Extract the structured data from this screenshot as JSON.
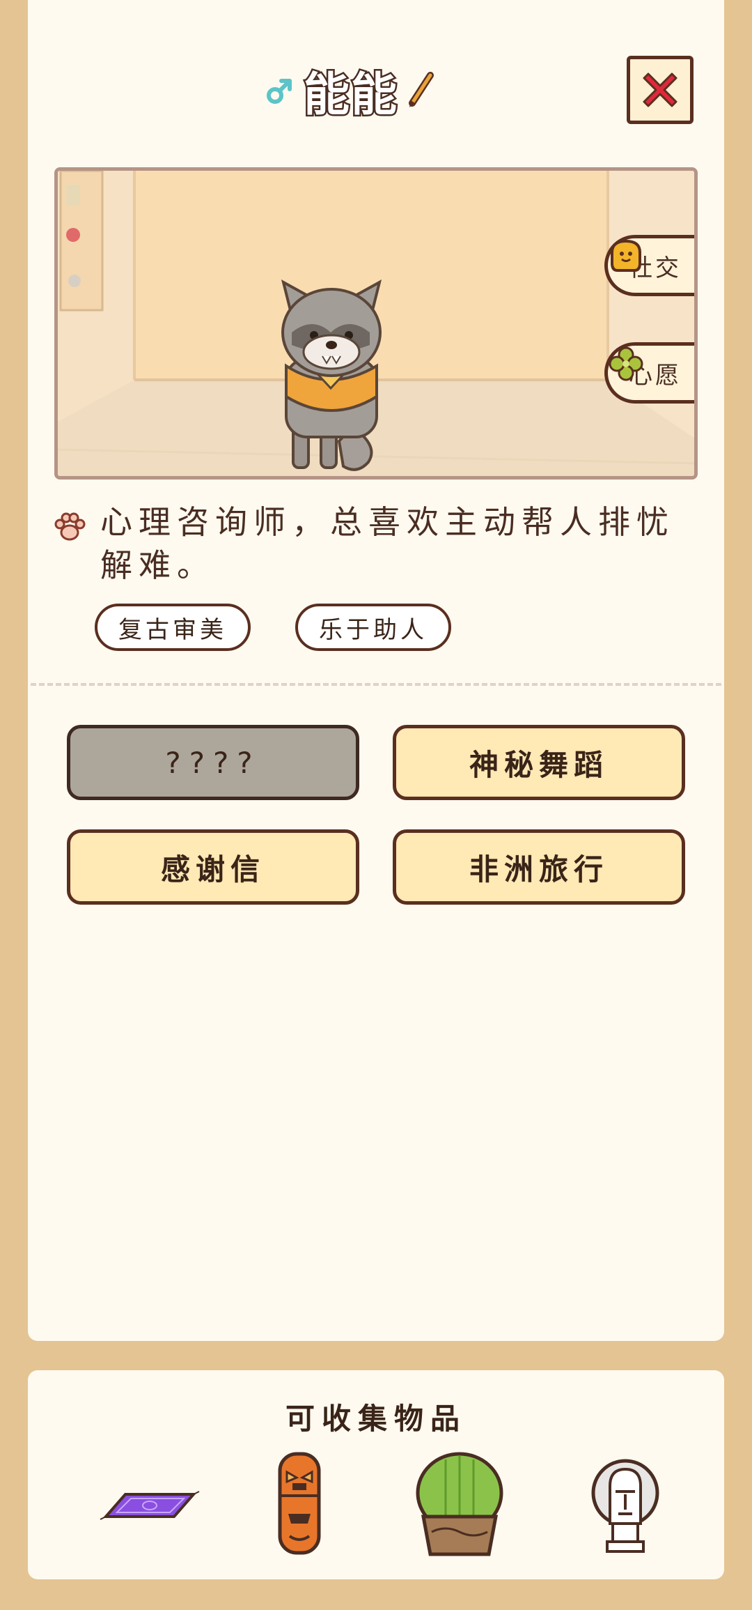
{
  "header": {
    "pet_name": "能能",
    "gender_icon": "male-symbol-icon",
    "edit_icon": "pencil-icon",
    "close_icon": "close-x-icon"
  },
  "scene": {
    "buttons": [
      {
        "label": "社交",
        "icon": "chat-face-icon"
      },
      {
        "label": "心愿",
        "icon": "clover-icon"
      }
    ]
  },
  "profile": {
    "description": "心理咨询师，总喜欢主动帮人排忧解难。",
    "tags": [
      "复古审美",
      "乐于助人"
    ]
  },
  "actions": [
    {
      "label": "????",
      "locked": true
    },
    {
      "label": "神秘舞蹈",
      "locked": false
    },
    {
      "label": "感谢信",
      "locked": false
    },
    {
      "label": "非洲旅行",
      "locked": false
    }
  ],
  "collectibles": {
    "title": "可收集物品",
    "items": [
      "purple-rug-icon",
      "tiki-totem-icon",
      "potted-cactus-icon",
      "moai-statue-icon"
    ]
  },
  "colors": {
    "background": "#e4c493",
    "card": "#fefaf0",
    "outline": "#5a2f1f",
    "button_fill": "#ffe9b5",
    "locked_fill": "#ada69b",
    "close_red": "#e0283a"
  }
}
